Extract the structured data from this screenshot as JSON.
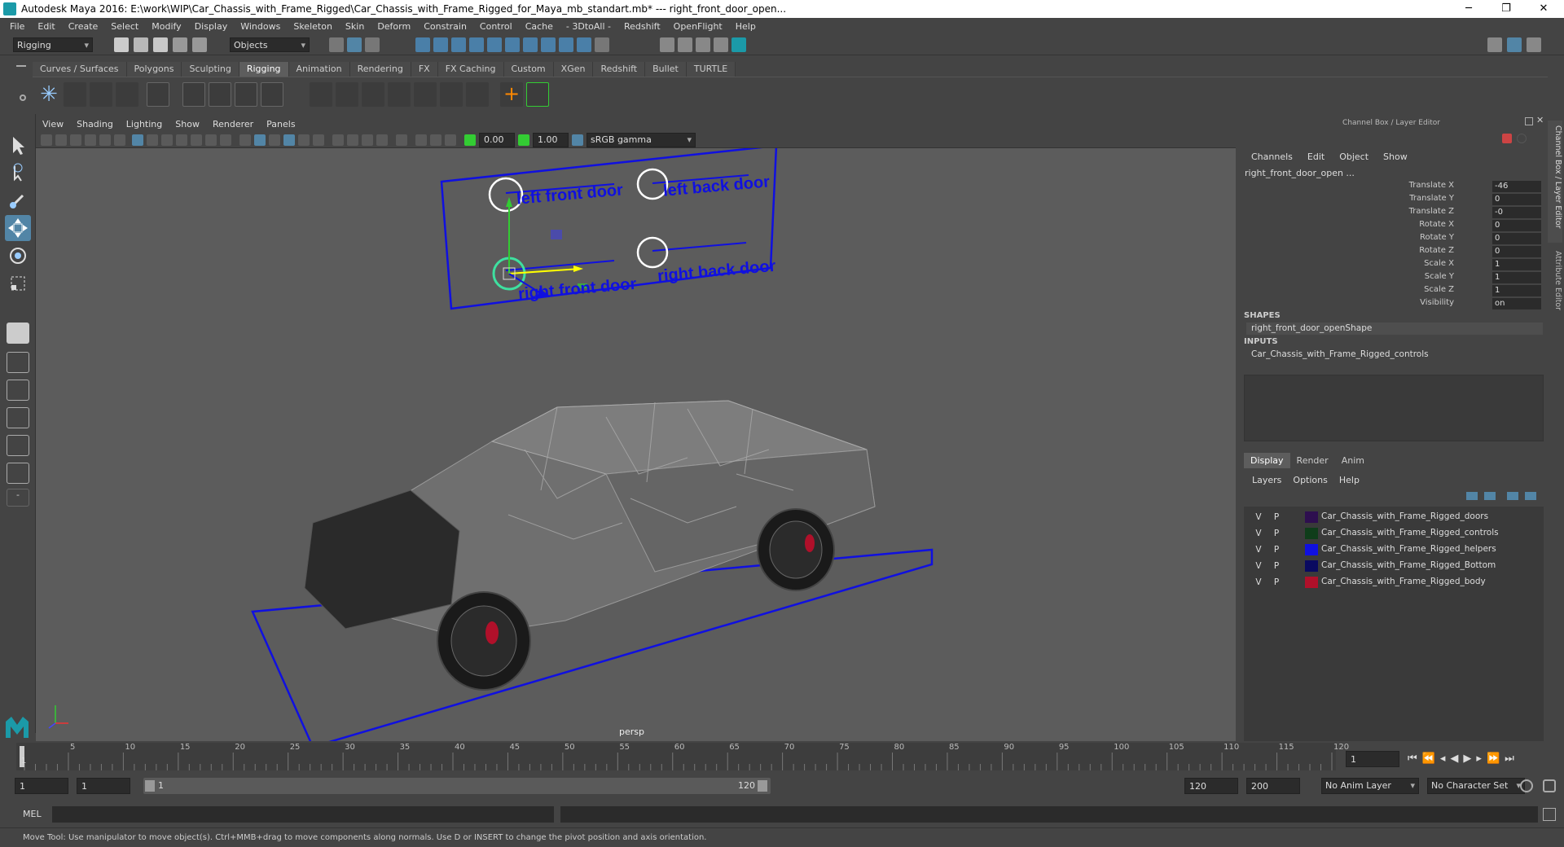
{
  "window": {
    "title": "Autodesk Maya 2016: E:\\work\\WIP\\Car_Chassis_with_Frame_Rigged\\Car_Chassis_with_Frame_Rigged_for_Maya_mb_standart.mb*   ---   right_front_door_open...",
    "minimize": "─",
    "maximize": "❐",
    "close": "✕"
  },
  "menubar": [
    "File",
    "Edit",
    "Create",
    "Select",
    "Modify",
    "Display",
    "Windows",
    "Skeleton",
    "Skin",
    "Deform",
    "Constrain",
    "Control",
    "Cache",
    "- 3DtoAll -",
    "Redshift",
    "OpenFlight",
    "Help"
  ],
  "statusline": {
    "mode": "Rigging",
    "selection": "Objects"
  },
  "shelf_tabs": [
    "Curves / Surfaces",
    "Polygons",
    "Sculpting",
    "Rigging",
    "Animation",
    "Rendering",
    "FX",
    "FX Caching",
    "Custom",
    "XGen",
    "Redshift",
    "Bullet",
    "TURTLE"
  ],
  "active_shelf": "Rigging",
  "viewport": {
    "menu": [
      "View",
      "Shading",
      "Lighting",
      "Show",
      "Renderer",
      "Panels"
    ],
    "exposure": "0.00",
    "gamma": "1.00",
    "color_space": "sRGB gamma",
    "camera_label": "persp",
    "control_labels": [
      "left front door",
      "left back door",
      "right front door",
      "right back door"
    ]
  },
  "channel_box": {
    "header": "Channel Box / Layer Editor",
    "menu": [
      "Channels",
      "Edit",
      "Object",
      "Show"
    ],
    "object_name": "right_front_door_open ...",
    "channels": [
      {
        "label": "Translate X",
        "value": "-46"
      },
      {
        "label": "Translate Y",
        "value": "0"
      },
      {
        "label": "Translate Z",
        "value": "-0"
      },
      {
        "label": "Rotate X",
        "value": "0"
      },
      {
        "label": "Rotate Y",
        "value": "0"
      },
      {
        "label": "Rotate Z",
        "value": "0"
      },
      {
        "label": "Scale X",
        "value": "1"
      },
      {
        "label": "Scale Y",
        "value": "1"
      },
      {
        "label": "Scale Z",
        "value": "1"
      },
      {
        "label": "Visibility",
        "value": "on"
      }
    ],
    "shapes_header": "SHAPES",
    "shape": "right_front_door_openShape",
    "inputs_header": "INPUTS",
    "input": "Car_Chassis_with_Frame_Rigged_controls",
    "side_tabs": [
      "Channel Box / Layer Editor",
      "Attribute Editor"
    ]
  },
  "layer_editor": {
    "tabs": [
      "Display",
      "Render",
      "Anim"
    ],
    "active_tab": "Display",
    "menu": [
      "Layers",
      "Options",
      "Help"
    ],
    "layers": [
      {
        "v": "V",
        "p": "P",
        "name": "Car_Chassis_with_Frame_Rigged_doors",
        "color": "#2e0f4f"
      },
      {
        "v": "V",
        "p": "P",
        "name": "Car_Chassis_with_Frame_Rigged_controls",
        "color": "#0f3d1a"
      },
      {
        "v": "V",
        "p": "P",
        "name": "Car_Chassis_with_Frame_Rigged_helpers",
        "color": "#1010e0"
      },
      {
        "v": "V",
        "p": "P",
        "name": "Car_Chassis_with_Frame_Rigged_Bottom",
        "color": "#0a0a60"
      },
      {
        "v": "V",
        "p": "P",
        "name": "Car_Chassis_with_Frame_Rigged_body",
        "color": "#b0102a"
      }
    ]
  },
  "timeline": {
    "ticks": [
      "1",
      "5",
      "10",
      "15",
      "20",
      "25",
      "30",
      "35",
      "40",
      "45",
      "50",
      "55",
      "60",
      "65",
      "70",
      "75",
      "80",
      "85",
      "90",
      "95",
      "100",
      "105",
      "110",
      "115",
      "120"
    ],
    "current_frame": "1"
  },
  "range": {
    "start": "1",
    "start_inner": "1",
    "slider_start": "1",
    "slider_end": "120",
    "end_inner": "120",
    "end": "200",
    "anim_layer": "No Anim Layer",
    "character_set": "No Character Set"
  },
  "command_line": {
    "label": "MEL"
  },
  "help_line": "Move Tool: Use manipulator to move object(s). Ctrl+MMB+drag to move components along normals. Use D or INSERT to change the pivot position and axis orientation.",
  "colors": {
    "accent": "#5285a6",
    "control_blue": "#1010e0",
    "selected_green": "#3ee0a0"
  }
}
